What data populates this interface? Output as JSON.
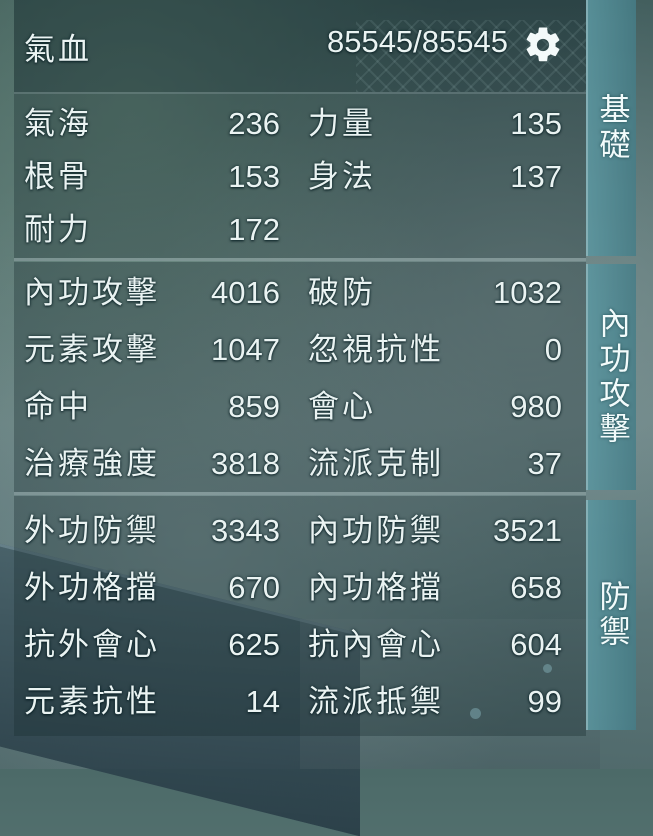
{
  "header": {
    "label": "氣血",
    "value": "85545/85545",
    "settings_icon": "gear-icon"
  },
  "tabs": [
    {
      "label": "基礎"
    },
    {
      "label": "內功攻擊"
    },
    {
      "label": "防禦"
    }
  ],
  "basic": {
    "left": [
      {
        "label": "氣海",
        "value": "236"
      },
      {
        "label": "根骨",
        "value": "153"
      },
      {
        "label": "耐力",
        "value": "172"
      }
    ],
    "right": [
      {
        "label": "力量",
        "value": "135"
      },
      {
        "label": "身法",
        "value": "137"
      }
    ]
  },
  "attack": {
    "left": [
      {
        "label": "內功攻擊",
        "value": "4016"
      },
      {
        "label": "元素攻擊",
        "value": "1047"
      },
      {
        "label": "命中",
        "value": "859"
      },
      {
        "label": "治療強度",
        "value": "3818"
      }
    ],
    "right": [
      {
        "label": "破防",
        "value": "1032"
      },
      {
        "label": "忽視抗性",
        "value": "0"
      },
      {
        "label": "會心",
        "value": "980"
      },
      {
        "label": "流派克制",
        "value": "37"
      }
    ]
  },
  "defense": {
    "left": [
      {
        "label": "外功防禦",
        "value": "3343"
      },
      {
        "label": "外功格擋",
        "value": "670"
      },
      {
        "label": "抗外會心",
        "value": "625"
      },
      {
        "label": "元素抗性",
        "value": "14"
      }
    ],
    "right": [
      {
        "label": "內功防禦",
        "value": "3521"
      },
      {
        "label": "內功格擋",
        "value": "658"
      },
      {
        "label": "抗內會心",
        "value": "604"
      },
      {
        "label": "流派抵禦",
        "value": "99"
      }
    ]
  }
}
